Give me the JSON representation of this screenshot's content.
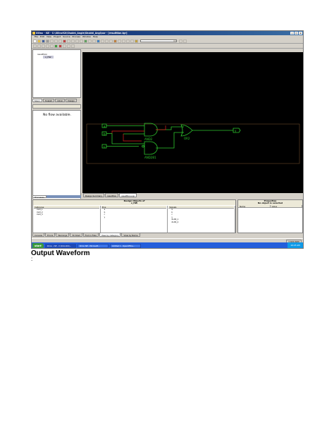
{
  "window": {
    "title": "Xilinx - ISE - C:\\Xilinx92i\\Shobhi_Angle\\Shobhi_Angl\\xor - [resulttion.tgr]",
    "controls": [
      "_",
      "□",
      "×"
    ]
  },
  "menu": [
    "File",
    "Edit",
    "View",
    "Project",
    "Source",
    "Process",
    "Window",
    "Help"
  ],
  "sources": {
    "root": "resulttion",
    "child": "x_HW"
  },
  "left_tabs": [
    "Sourc",
    "Snapsh",
    "Librar",
    "Design"
  ],
  "processes": {
    "empty_message": "No flow available."
  },
  "processes_tab": "Processes",
  "schematic": {
    "inputs": [
      "a",
      "b",
      "c"
    ],
    "output": "y",
    "gates": [
      "AND2",
      "OR2",
      "AND2B1"
    ]
  },
  "doc_tabs": [
    "Design Summary",
    "resulttion",
    "resulttion.ngr"
  ],
  "design_objects": {
    "title": "Design Objects of",
    "subtitle": "x_HW",
    "columns": [
      "Instances",
      "Pins",
      "Signals"
    ],
    "instances": [
      "XLXI_1",
      "XLXI_2",
      "XLXI_3"
    ],
    "pins": [
      "a",
      "b",
      "c",
      "y"
    ],
    "signals": [
      "a",
      "b",
      "c",
      "y",
      "XLXN_1",
      "XLXN_2"
    ]
  },
  "properties": {
    "title": "Properties",
    "subtitle": "No object is selected",
    "columns": [
      "Name",
      "Value"
    ]
  },
  "bottom_tabs": [
    "Console",
    "Errors",
    "Warnings",
    "Tcl Shell",
    "Find in Files",
    "View by Category",
    "View by Name"
  ],
  "status": {
    "coordinates": "[1990,668]"
  },
  "taskbar": {
    "start": "start",
    "items": [
      "Xilinx - ISE - C:\\Xilinx92i\\...",
      "Xilinx ISE - Microsoft...",
      "Untitled 1 - OpenOffice..."
    ],
    "clock": "10:23 AM"
  },
  "caption": "Output Waveform",
  "caption_note": ":"
}
